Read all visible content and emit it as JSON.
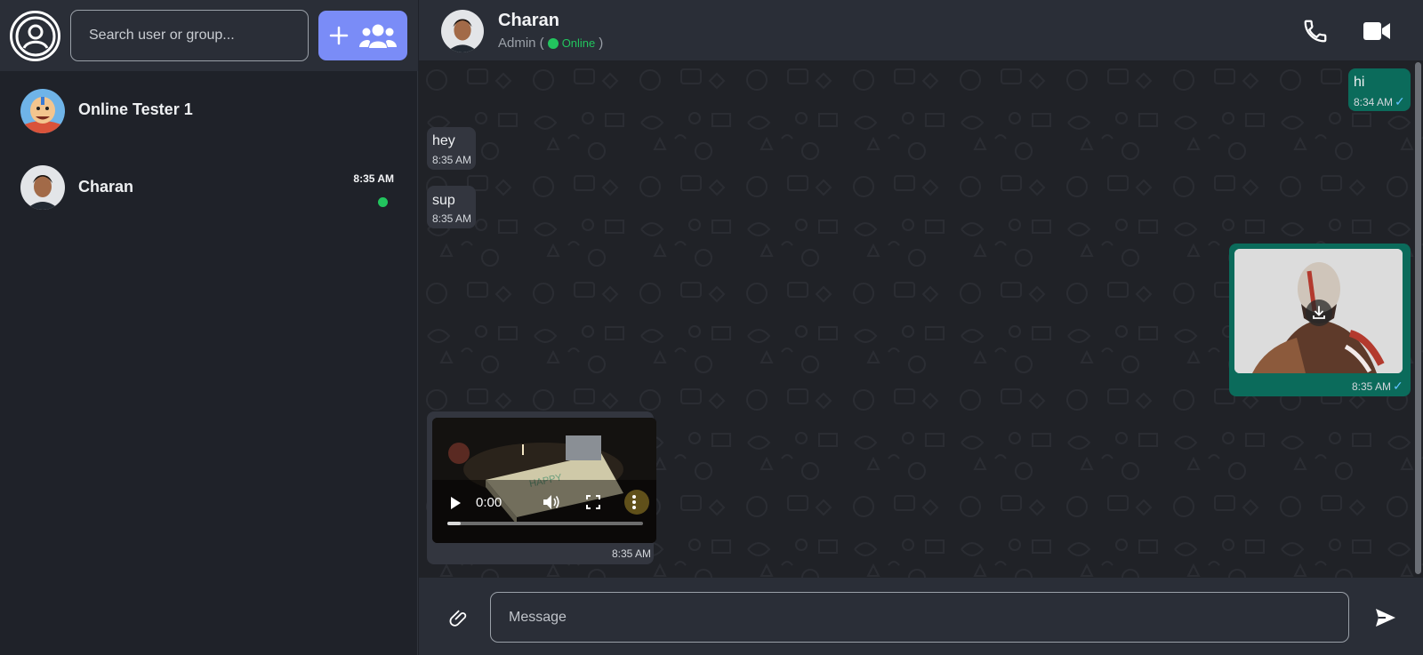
{
  "sidebar": {
    "search": {
      "placeholder": "Search user or group..."
    },
    "chats": [
      {
        "name": "Online Tester 1",
        "time": "",
        "avatar": "cartoon-avatar"
      },
      {
        "name": "Charan",
        "time": "8:35 AM",
        "avatar": "photo-avatar",
        "online": true
      }
    ]
  },
  "header": {
    "name": "Charan",
    "role": "Admin (",
    "status": "Online",
    "close_paren": ")"
  },
  "messages": [
    {
      "direction": "out",
      "text": "hi",
      "time": "8:34 AM"
    },
    {
      "direction": "in",
      "text": "hey",
      "time": "8:35 AM"
    },
    {
      "direction": "in",
      "text": "sup",
      "time": "8:35 AM"
    },
    {
      "direction": "out",
      "type": "image",
      "time": "8:35 AM"
    },
    {
      "direction": "in",
      "type": "video",
      "video_time": "0:00",
      "progress": 0.07,
      "time": "8:35 AM"
    }
  ],
  "composer": {
    "placeholder": "Message"
  },
  "colors": {
    "accent": "#7a8cf7",
    "outgoing_bubble": "#0b6b5b",
    "incoming_bubble": "#33363f",
    "online": "#22c55e"
  }
}
